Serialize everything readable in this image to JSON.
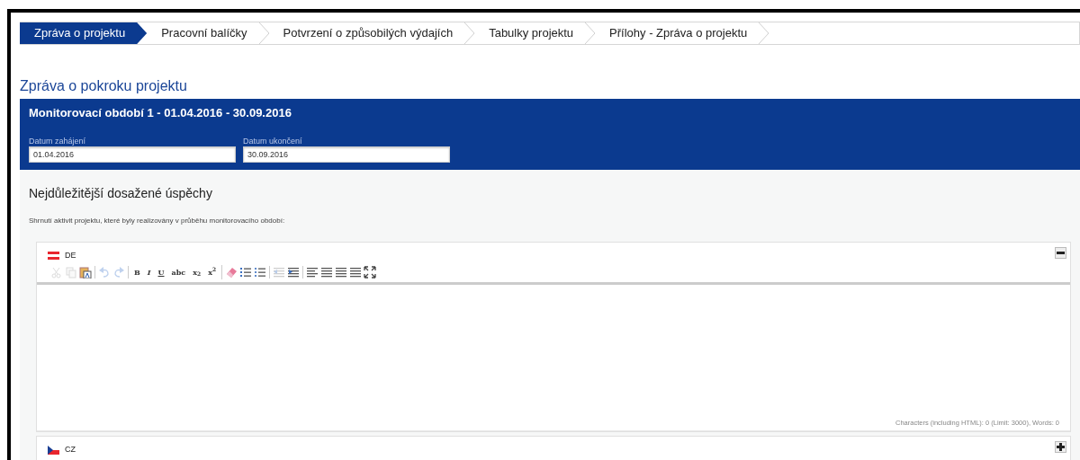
{
  "tabs": [
    {
      "label": "Zpráva o projektu",
      "selected": true
    },
    {
      "label": "Pracovní balíčky",
      "selected": false
    },
    {
      "label": "Potvrzení o způsobilých výdajích",
      "selected": false
    },
    {
      "label": "Tabulky projektu",
      "selected": false
    },
    {
      "label": "Přílohy - Zpráva o projektu",
      "selected": false
    }
  ],
  "page_title": "Zpráva o pokroku projektu",
  "period": {
    "title": "Monitorovací období 1 - 01.04.2016 - 30.09.2016",
    "fields": [
      {
        "label": "Datum zahájení",
        "value": "01.04.2016"
      },
      {
        "label": "Datum ukončení",
        "value": "30.09.2016"
      }
    ]
  },
  "section": {
    "title": "Nejdůležitější dosažené úspěchy",
    "description": "Shrnutí aktivit projektu, které byly realizovány v průběhu monitorovacího období:"
  },
  "languages": [
    {
      "code": "DE",
      "kind": "at",
      "expanded": true,
      "toolbar": [
        [
          {
            "kind": "cut",
            "disabled": true
          },
          {
            "kind": "copy",
            "disabled": true
          },
          {
            "kind": "paste",
            "disabled": false
          }
        ],
        [
          {
            "kind": "undo",
            "disabled": true
          },
          {
            "kind": "redo",
            "disabled": true
          }
        ],
        [
          {
            "kind": "text",
            "label": "B",
            "disabled": false
          },
          {
            "kind": "text",
            "label": "I",
            "disabled": false
          },
          {
            "kind": "text",
            "label": "U",
            "disabled": false
          },
          {
            "kind": "text",
            "label": "abc",
            "disabled": false
          },
          {
            "kind": "text",
            "label": "x$_{2}$",
            "disabled": false
          },
          {
            "kind": "text",
            "label": "x$^{2}$",
            "disabled": false
          }
        ],
        [
          {
            "kind": "eraser",
            "disabled": false
          },
          {
            "kind": "numbered-list",
            "disabled": false
          },
          {
            "kind": "bullet-list",
            "disabled": false
          }
        ],
        [
          {
            "kind": "outdent",
            "disabled": true
          },
          {
            "kind": "indent",
            "disabled": false
          }
        ],
        [
          {
            "kind": "align-left",
            "disabled": false
          },
          {
            "kind": "align-center",
            "disabled": false
          },
          {
            "kind": "align-right",
            "disabled": false
          },
          {
            "kind": "justify",
            "disabled": false
          },
          {
            "kind": "maximize",
            "disabled": false
          }
        ]
      ],
      "counter": "Characters (including HTML): 0 (Limit: 3000), Words: 0"
    },
    {
      "code": "CZ",
      "kind": "cz",
      "expanded": false
    }
  ]
}
